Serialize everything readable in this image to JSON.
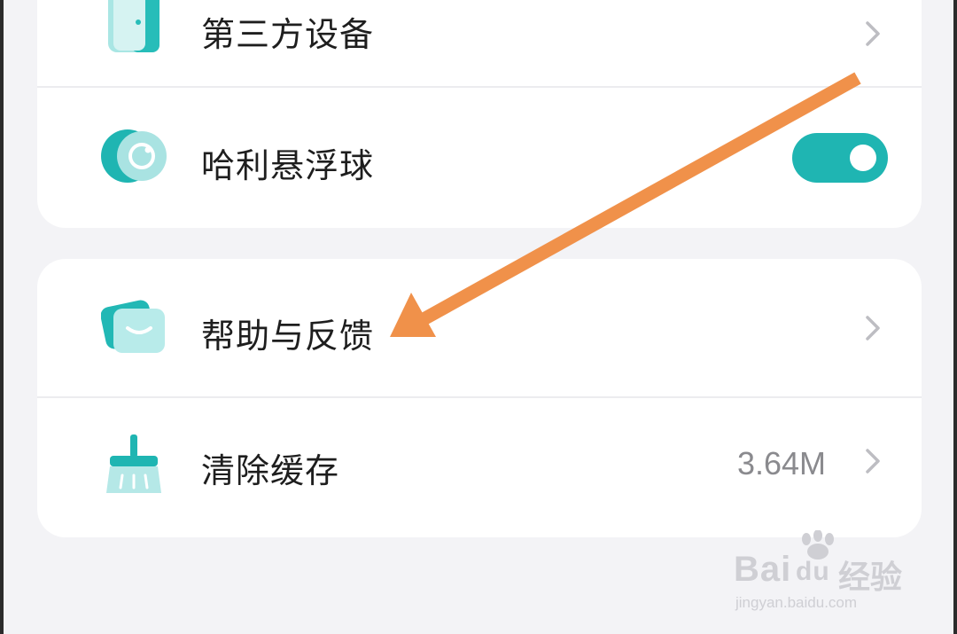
{
  "settings": {
    "group1": [
      {
        "label": "第三方设备",
        "icon": "third-party-device-icon",
        "control": "chevron"
      },
      {
        "label": "哈利悬浮球",
        "icon": "floating-ball-icon",
        "control": "toggle",
        "toggle_on": true
      }
    ],
    "group2": [
      {
        "label": "帮助与反馈",
        "icon": "help-feedback-icon",
        "control": "chevron"
      },
      {
        "label": "清除缓存",
        "icon": "clear-cache-icon",
        "control": "chevron",
        "value": "3.64M"
      }
    ]
  },
  "colors": {
    "accent": "#1fb5b2",
    "annotation_arrow": "#f0914a",
    "background": "#f3f3f6",
    "card": "#ffffff"
  },
  "watermark": {
    "logo": "Bai",
    "logo_paw": "du",
    "label": "经验",
    "url": "jingyan.baidu.com"
  }
}
